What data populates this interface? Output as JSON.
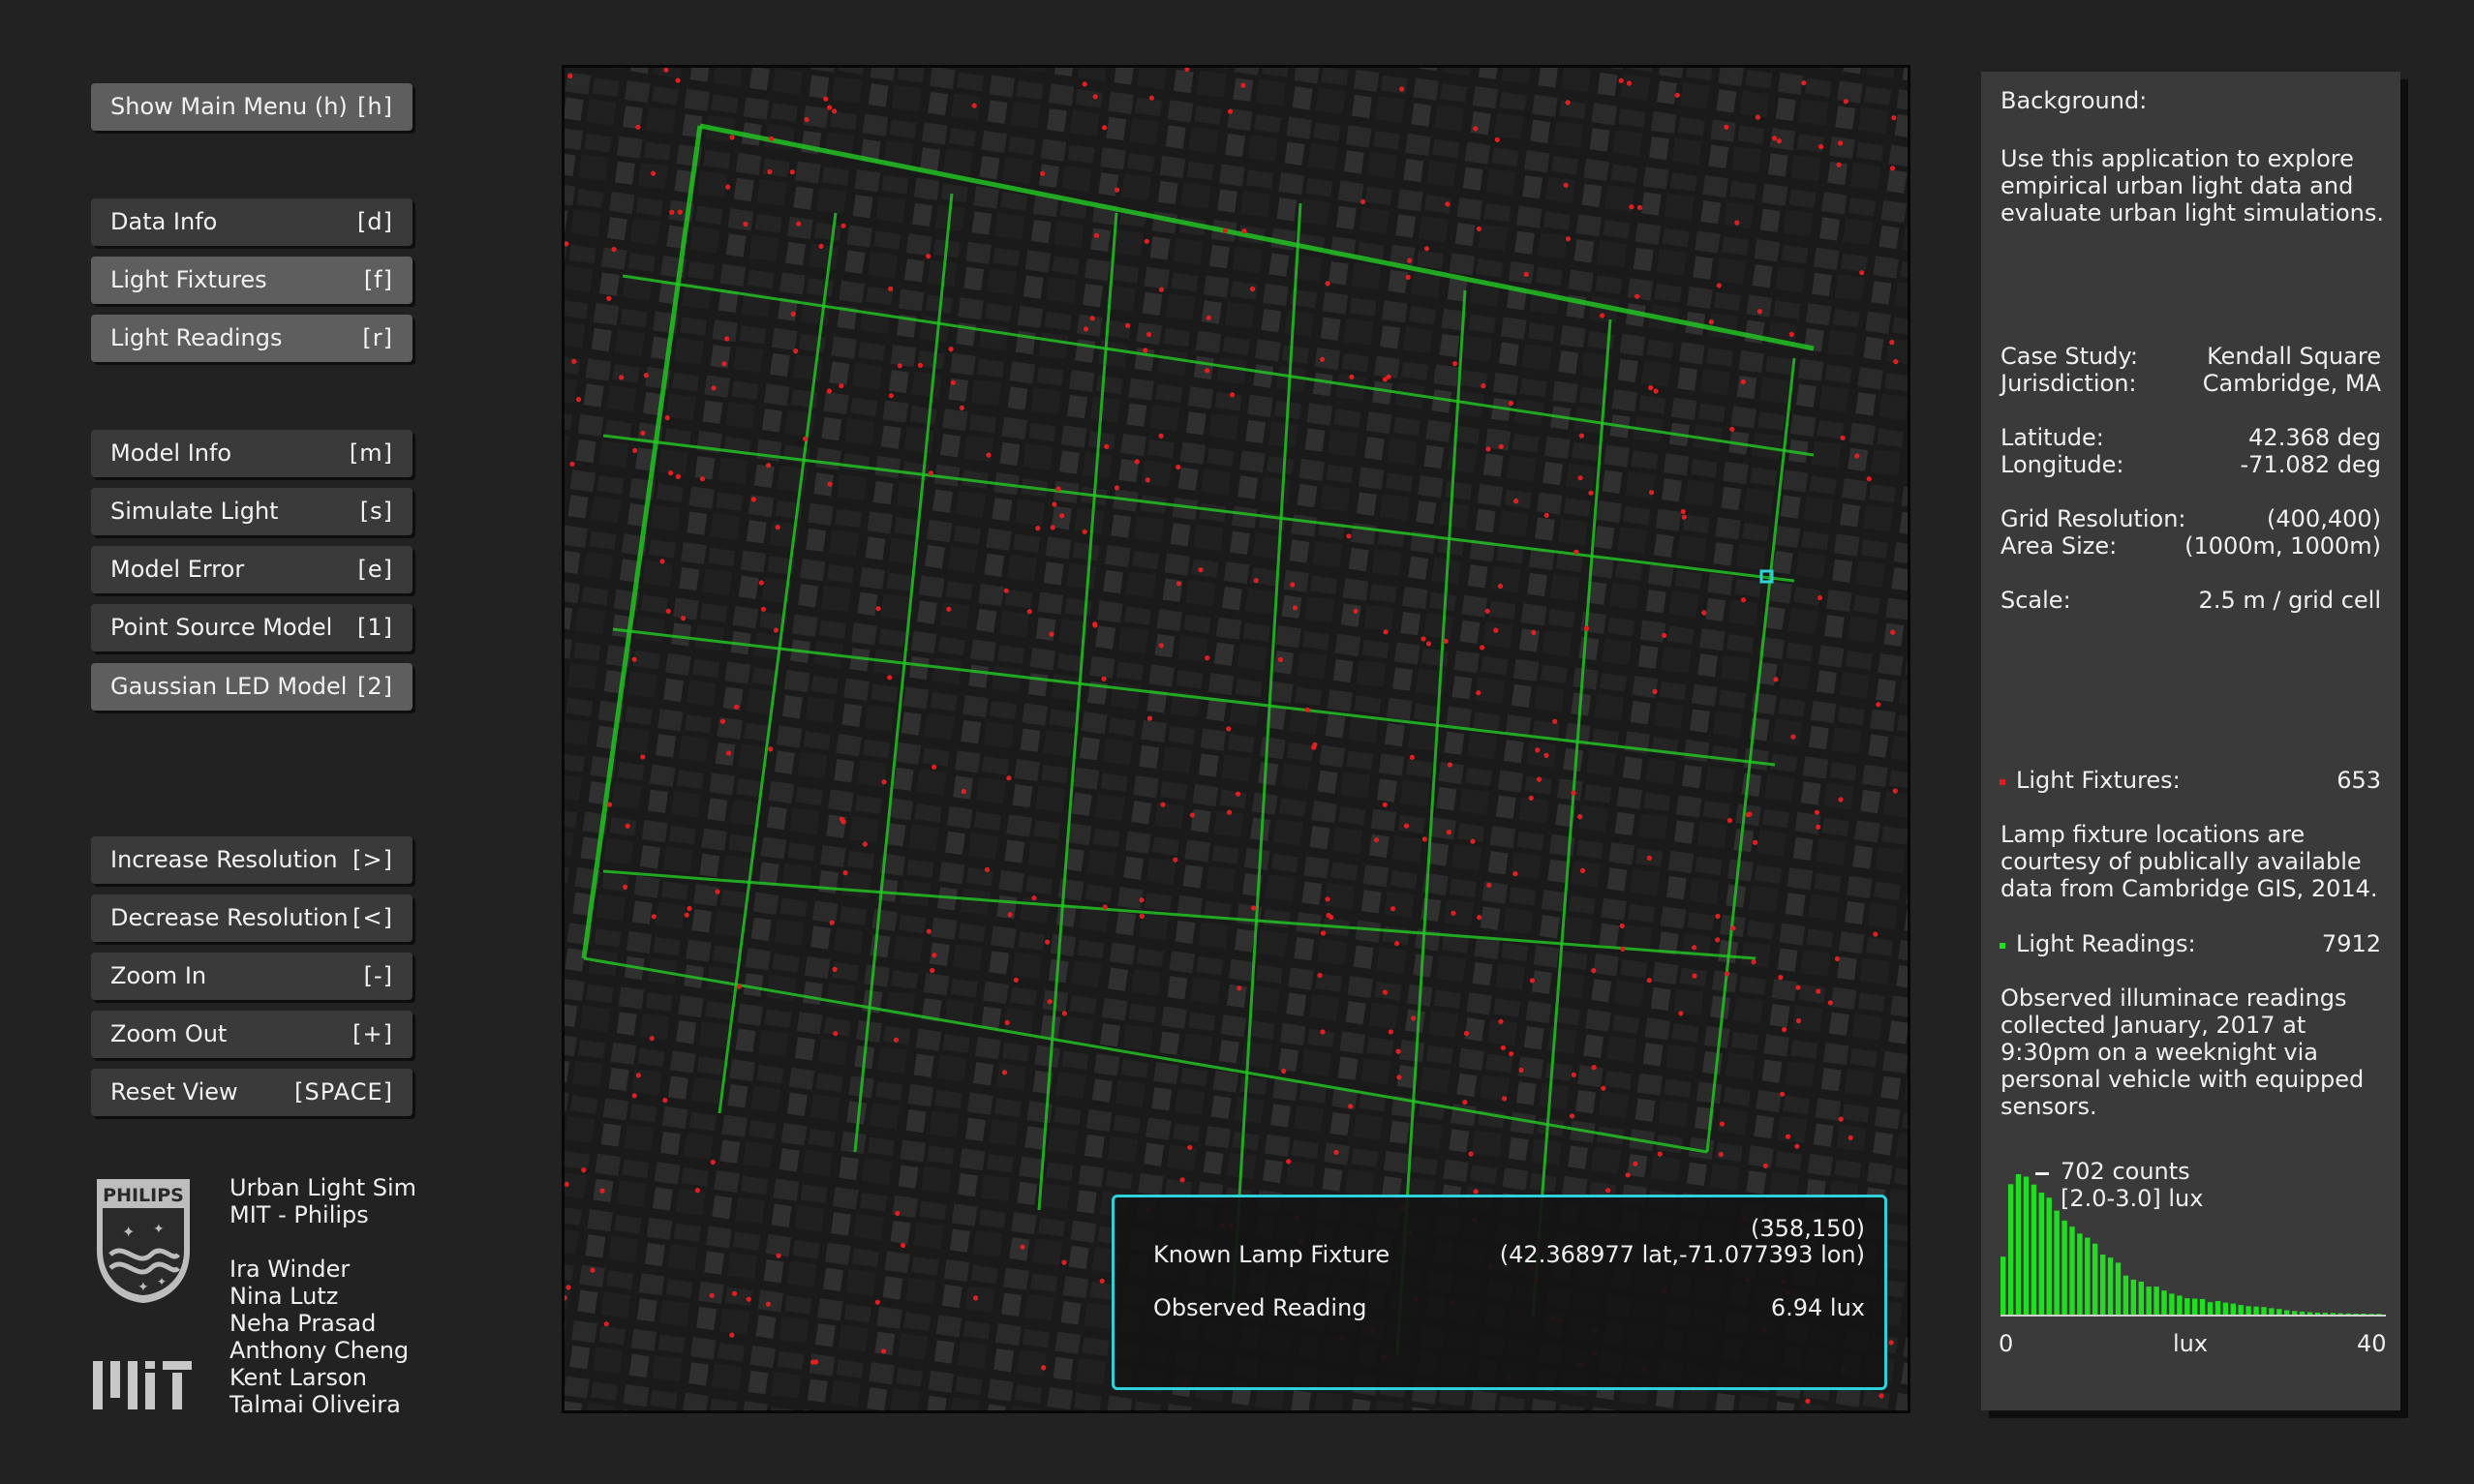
{
  "menu": {
    "main": {
      "label": "Show Main Menu (h)",
      "key": "[h]"
    },
    "data_info": {
      "label": "Data Info",
      "key": "[d]"
    },
    "light_fixtures": {
      "label": "Light Fixtures",
      "key": "[f]"
    },
    "light_readings": {
      "label": "Light Readings",
      "key": "[r]"
    },
    "model_info": {
      "label": "Model Info",
      "key": "[m]"
    },
    "simulate_light": {
      "label": "Simulate Light",
      "key": "[s]"
    },
    "model_error": {
      "label": "Model Error",
      "key": "[e]"
    },
    "point_source": {
      "label": "Point Source Model",
      "key": "[1]"
    },
    "gaussian_led": {
      "label": "Gaussian LED Model",
      "key": "[2]"
    },
    "increase_res": {
      "label": "Increase Resolution",
      "key": "[>]"
    },
    "decrease_res": {
      "label": "Decrease Resolution",
      "key": "[<]"
    },
    "zoom_in": {
      "label": "Zoom In",
      "key": "[-]"
    },
    "zoom_out": {
      "label": "Zoom Out",
      "key": "[+]"
    },
    "reset_view": {
      "label": "Reset View",
      "key": "[SPACE]"
    }
  },
  "credits": {
    "app": "Urban Light Sim",
    "org": "MIT - Philips",
    "authors": [
      "Ira Winder",
      "Nina Lutz",
      "Neha Prasad",
      "Anthony Cheng",
      "Kent Larson",
      "Talmai Oliveira"
    ],
    "philips_logo_text": "PHILIPS"
  },
  "popup": {
    "coord": "(358,150)",
    "fixture_label": "Known Lamp Fixture",
    "latlon": "(42.368977 lat,-71.077393 lon)",
    "reading_label": "Observed Reading",
    "reading_value": "6.94 lux"
  },
  "panel": {
    "background_title": "Background:",
    "background_text": "Use this application to explore empirical urban light data and evaluate urban light simulations.",
    "case_study_label": "Case Study:",
    "case_study_value": "Kendall Square",
    "jurisdiction_label": "Jurisdiction:",
    "jurisdiction_value": "Cambridge, MA",
    "latitude_label": "Latitude:",
    "latitude_value": "42.368 deg",
    "longitude_label": "Longitude:",
    "longitude_value": "-71.082 deg",
    "grid_res_label": "Grid Resolution:",
    "grid_res_value": "(400,400)",
    "area_label": "Area Size:",
    "area_value": "(1000m, 1000m)",
    "scale_label": "Scale:",
    "scale_value": "2.5 m / grid cell",
    "fixtures_label": "Light Fixtures:",
    "fixtures_count": "653",
    "fixtures_text": "Lamp fixture locations are courtesy of publically available data from Cambridge GIS, 2014.",
    "readings_label": "Light Readings:",
    "readings_count": "7912",
    "readings_text": "Observed illuminace readings collected January, 2017 at 9:30pm on a weeknight via personal vehicle with equipped sensors."
  },
  "histogram": {
    "peak_label": "702 counts",
    "peak_range": "[2.0-3.0] lux",
    "x_min": "0",
    "x_label": "lux",
    "x_max": "40",
    "bar_color": "#22dd22",
    "counts": [
      290,
      652,
      702,
      690,
      650,
      610,
      585,
      520,
      470,
      440,
      405,
      385,
      355,
      300,
      285,
      260,
      195,
      175,
      165,
      140,
      140,
      120,
      105,
      95,
      82,
      80,
      78,
      62,
      68,
      60,
      55,
      48,
      42,
      40,
      38,
      32,
      28,
      22,
      18,
      15,
      12,
      10,
      9,
      8,
      7,
      6,
      5,
      5,
      4,
      4
    ]
  },
  "colors": {
    "fixture": "#e02020",
    "reading": "#22e022",
    "highlight": "#2ed1d9",
    "panel_bg": "#3a3a3a",
    "button_active": "#5e5e5e"
  }
}
